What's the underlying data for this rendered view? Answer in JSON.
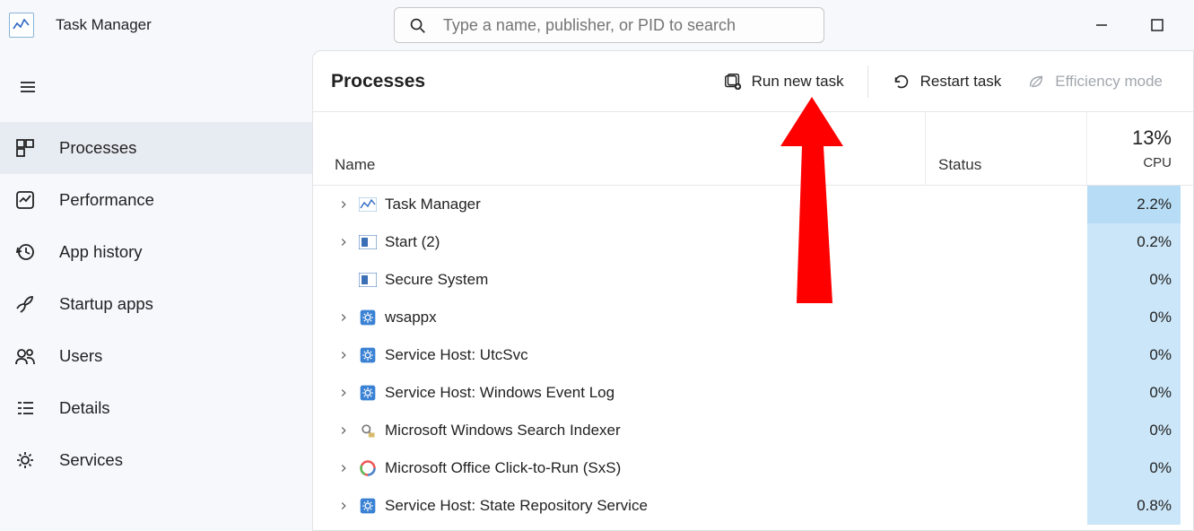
{
  "app": {
    "title": "Task Manager"
  },
  "search": {
    "placeholder": "Type a name, publisher, or PID to search"
  },
  "sidebar": {
    "items": [
      {
        "label": "Processes",
        "icon": "processes-icon",
        "active": true
      },
      {
        "label": "Performance",
        "icon": "performance-icon",
        "active": false
      },
      {
        "label": "App history",
        "icon": "history-icon",
        "active": false
      },
      {
        "label": "Startup apps",
        "icon": "startup-icon",
        "active": false
      },
      {
        "label": "Users",
        "icon": "users-icon",
        "active": false
      },
      {
        "label": "Details",
        "icon": "details-icon",
        "active": false
      },
      {
        "label": "Services",
        "icon": "services-icon",
        "active": false
      }
    ]
  },
  "toolbar": {
    "heading": "Processes",
    "run_label": "Run new task",
    "restart_label": "Restart task",
    "efficiency_label": "Efficiency mode"
  },
  "columns": {
    "name": "Name",
    "status": "Status",
    "cpu_label": "CPU",
    "cpu_total": "13%"
  },
  "processes": [
    {
      "name": "Task Manager",
      "cpu": "2.2%",
      "icon": "taskmgr",
      "expandable": true,
      "heat": "h1"
    },
    {
      "name": "Start (2)",
      "cpu": "0.2%",
      "icon": "app",
      "expandable": true,
      "heat": "h0"
    },
    {
      "name": "Secure System",
      "cpu": "0%",
      "icon": "app",
      "expandable": false,
      "heat": "h0"
    },
    {
      "name": "wsappx",
      "cpu": "0%",
      "icon": "gear",
      "expandable": true,
      "heat": "h0"
    },
    {
      "name": "Service Host: UtcSvc",
      "cpu": "0%",
      "icon": "gear",
      "expandable": true,
      "heat": "h0"
    },
    {
      "name": "Service Host: Windows Event Log",
      "cpu": "0%",
      "icon": "gear",
      "expandable": true,
      "heat": "h0"
    },
    {
      "name": "Microsoft Windows Search Indexer",
      "cpu": "0%",
      "icon": "search",
      "expandable": true,
      "heat": "h0"
    },
    {
      "name": "Microsoft Office Click-to-Run (SxS)",
      "cpu": "0%",
      "icon": "office",
      "expandable": true,
      "heat": "h0"
    },
    {
      "name": "Service Host: State Repository Service",
      "cpu": "0.8%",
      "icon": "gear",
      "expandable": true,
      "heat": "h0"
    }
  ]
}
